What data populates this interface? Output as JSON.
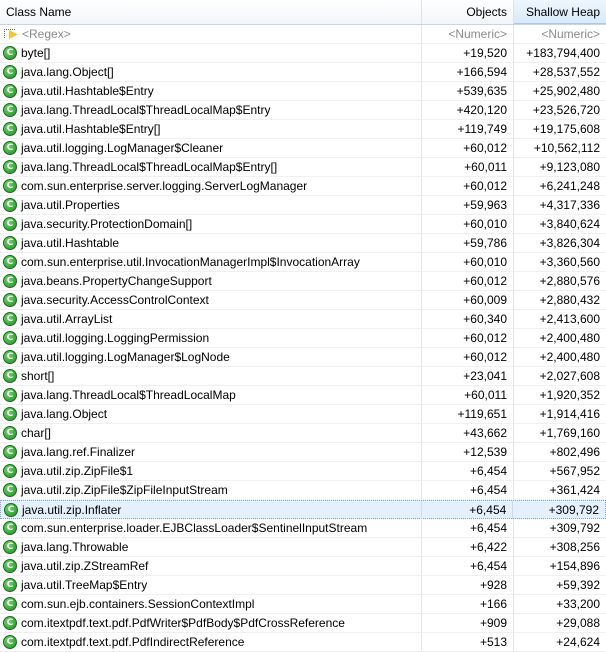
{
  "columns": {
    "class_name": "Class Name",
    "objects": "Objects",
    "shallow_heap": "Shallow Heap"
  },
  "filter_row": {
    "class_name": "<Regex>",
    "objects": "<Numeric>",
    "shallow_heap": "<Numeric>"
  },
  "icon_letter": "C",
  "rows": [
    {
      "name": "byte[]",
      "objects": "+19,520",
      "heap": "+183,794,400"
    },
    {
      "name": "java.lang.Object[]",
      "objects": "+166,594",
      "heap": "+28,537,552"
    },
    {
      "name": "java.util.Hashtable$Entry",
      "objects": "+539,635",
      "heap": "+25,902,480"
    },
    {
      "name": "java.lang.ThreadLocal$ThreadLocalMap$Entry",
      "objects": "+420,120",
      "heap": "+23,526,720"
    },
    {
      "name": "java.util.Hashtable$Entry[]",
      "objects": "+119,749",
      "heap": "+19,175,608"
    },
    {
      "name": "java.util.logging.LogManager$Cleaner",
      "objects": "+60,012",
      "heap": "+10,562,112"
    },
    {
      "name": "java.lang.ThreadLocal$ThreadLocalMap$Entry[]",
      "objects": "+60,011",
      "heap": "+9,123,080"
    },
    {
      "name": "com.sun.enterprise.server.logging.ServerLogManager",
      "objects": "+60,012",
      "heap": "+6,241,248"
    },
    {
      "name": "java.util.Properties",
      "objects": "+59,963",
      "heap": "+4,317,336"
    },
    {
      "name": "java.security.ProtectionDomain[]",
      "objects": "+60,010",
      "heap": "+3,840,624"
    },
    {
      "name": "java.util.Hashtable",
      "objects": "+59,786",
      "heap": "+3,826,304"
    },
    {
      "name": "com.sun.enterprise.util.InvocationManagerImpl$InvocationArray",
      "objects": "+60,010",
      "heap": "+3,360,560"
    },
    {
      "name": "java.beans.PropertyChangeSupport",
      "objects": "+60,012",
      "heap": "+2,880,576"
    },
    {
      "name": "java.security.AccessControlContext",
      "objects": "+60,009",
      "heap": "+2,880,432"
    },
    {
      "name": "java.util.ArrayList",
      "objects": "+60,340",
      "heap": "+2,413,600"
    },
    {
      "name": "java.util.logging.LoggingPermission",
      "objects": "+60,012",
      "heap": "+2,400,480"
    },
    {
      "name": "java.util.logging.LogManager$LogNode",
      "objects": "+60,012",
      "heap": "+2,400,480"
    },
    {
      "name": "short[]",
      "objects": "+23,041",
      "heap": "+2,027,608"
    },
    {
      "name": "java.lang.ThreadLocal$ThreadLocalMap",
      "objects": "+60,011",
      "heap": "+1,920,352"
    },
    {
      "name": "java.lang.Object",
      "objects": "+119,651",
      "heap": "+1,914,416"
    },
    {
      "name": "char[]",
      "objects": "+43,662",
      "heap": "+1,769,160"
    },
    {
      "name": "java.lang.ref.Finalizer",
      "objects": "+12,539",
      "heap": "+802,496"
    },
    {
      "name": "java.util.zip.ZipFile$1",
      "objects": "+6,454",
      "heap": "+567,952"
    },
    {
      "name": "java.util.zip.ZipFile$ZipFileInputStream",
      "objects": "+6,454",
      "heap": "+361,424"
    },
    {
      "name": "java.util.zip.Inflater",
      "objects": "+6,454",
      "heap": "+309,792",
      "selected": true
    },
    {
      "name": "com.sun.enterprise.loader.EJBClassLoader$SentinelInputStream",
      "objects": "+6,454",
      "heap": "+309,792"
    },
    {
      "name": "java.lang.Throwable",
      "objects": "+6,422",
      "heap": "+308,256"
    },
    {
      "name": "java.util.zip.ZStreamRef",
      "objects": "+6,454",
      "heap": "+154,896"
    },
    {
      "name": "java.util.TreeMap$Entry",
      "objects": "+928",
      "heap": "+59,392"
    },
    {
      "name": "com.sun.ejb.containers.SessionContextImpl",
      "objects": "+166",
      "heap": "+33,200"
    },
    {
      "name": "com.itextpdf.text.pdf.PdfWriter$PdfBody$PdfCrossReference",
      "objects": "+909",
      "heap": "+29,088"
    },
    {
      "name": "com.itextpdf.text.pdf.PdfIndirectReference",
      "objects": "+513",
      "heap": "+24,624"
    }
  ]
}
